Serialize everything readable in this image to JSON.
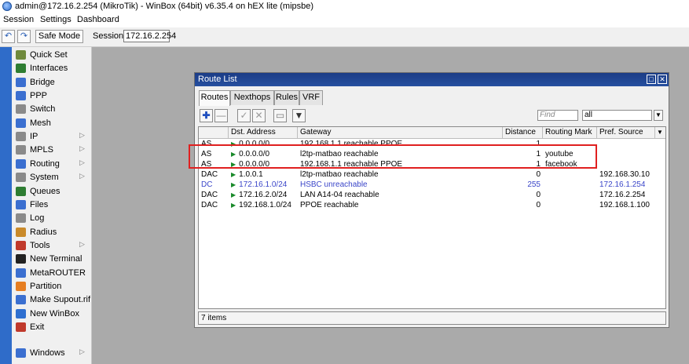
{
  "window": {
    "title": "admin@172.16.2.254 (MikroTik) - WinBox (64bit) v6.35.4 on hEX lite (mipsbe)"
  },
  "menu": [
    "Session",
    "Settings",
    "Dashboard"
  ],
  "toolbar": {
    "undo_icon": "undo-icon",
    "redo_icon": "redo-icon",
    "safe_mode_label": "Safe Mode",
    "session_label": "Session:",
    "session_value": "172.16.2.254"
  },
  "sidebar": {
    "items": [
      {
        "label": "Quick Set",
        "icon": "quick-set-icon",
        "color": "#6f8a3c",
        "submenu": false
      },
      {
        "label": "Interfaces",
        "icon": "interfaces-icon",
        "color": "#2e7d32",
        "submenu": false
      },
      {
        "label": "Bridge",
        "icon": "bridge-icon",
        "color": "#3b6fd0",
        "submenu": false
      },
      {
        "label": "PPP",
        "icon": "ppp-icon",
        "color": "#3b6fd0",
        "submenu": false
      },
      {
        "label": "Switch",
        "icon": "switch-icon",
        "color": "#8a8a8a",
        "submenu": false
      },
      {
        "label": "Mesh",
        "icon": "mesh-icon",
        "color": "#3b6fd0",
        "submenu": false
      },
      {
        "label": "IP",
        "icon": "ip-icon",
        "color": "#8a8a8a",
        "submenu": true
      },
      {
        "label": "MPLS",
        "icon": "mpls-icon",
        "color": "#8a8a8a",
        "submenu": true
      },
      {
        "label": "Routing",
        "icon": "routing-icon",
        "color": "#3b6fd0",
        "submenu": true
      },
      {
        "label": "System",
        "icon": "system-icon",
        "color": "#8a8a8a",
        "submenu": true
      },
      {
        "label": "Queues",
        "icon": "queues-icon",
        "color": "#2e7d32",
        "submenu": false
      },
      {
        "label": "Files",
        "icon": "files-icon",
        "color": "#3b6fd0",
        "submenu": false
      },
      {
        "label": "Log",
        "icon": "log-icon",
        "color": "#8a8a8a",
        "submenu": false
      },
      {
        "label": "Radius",
        "icon": "radius-icon",
        "color": "#c98a2a",
        "submenu": false
      },
      {
        "label": "Tools",
        "icon": "tools-icon",
        "color": "#c0392b",
        "submenu": true
      },
      {
        "label": "New Terminal",
        "icon": "terminal-icon",
        "color": "#222222",
        "submenu": false
      },
      {
        "label": "MetaROUTER",
        "icon": "metarouter-icon",
        "color": "#3b6fd0",
        "submenu": false
      },
      {
        "label": "Partition",
        "icon": "partition-icon",
        "color": "#e67e22",
        "submenu": false
      },
      {
        "label": "Make Supout.rif",
        "icon": "supout-icon",
        "color": "#3b6fd0",
        "submenu": false
      },
      {
        "label": "New WinBox",
        "icon": "winbox-icon",
        "color": "#2e6fd0",
        "submenu": false
      },
      {
        "label": "Exit",
        "icon": "exit-icon",
        "color": "#c0392b",
        "submenu": false
      }
    ],
    "windows": {
      "label": "Windows",
      "icon": "windows-icon",
      "color": "#3b6fd0",
      "submenu": true
    }
  },
  "route_list": {
    "title": "Route List",
    "tabs": [
      "Routes",
      "Nexthops",
      "Rules",
      "VRF"
    ],
    "active_tab": "Routes",
    "find_placeholder": "Find",
    "filter_value": "all",
    "columns": [
      "",
      "Dst. Address",
      "Gateway",
      "Distance",
      "Routing Mark",
      "Pref. Source"
    ],
    "rows": [
      {
        "flags": "AS",
        "dst": "0.0.0.0/0",
        "gateway": "192.168.1.1 reachable PPOE",
        "distance": "1",
        "mark": "",
        "pref": "",
        "blue": false
      },
      {
        "flags": "AS",
        "dst": "0.0.0.0/0",
        "gateway": "l2tp-matbao reachable",
        "distance": "1",
        "mark": "youtube",
        "pref": "",
        "blue": false
      },
      {
        "flags": "AS",
        "dst": "0.0.0.0/0",
        "gateway": "192.168.1.1 reachable PPOE",
        "distance": "1",
        "mark": "facebook",
        "pref": "",
        "blue": false
      },
      {
        "flags": "DAC",
        "dst": "1.0.0.1",
        "gateway": "l2tp-matbao reachable",
        "distance": "0",
        "mark": "",
        "pref": "192.168.30.10",
        "blue": false
      },
      {
        "flags": "DC",
        "dst": "172.16.1.0/24",
        "gateway": "HSBC unreachable",
        "distance": "255",
        "mark": "",
        "pref": "172.16.1.254",
        "blue": true
      },
      {
        "flags": "DAC",
        "dst": "172.16.2.0/24",
        "gateway": "LAN A14-04 reachable",
        "distance": "0",
        "mark": "",
        "pref": "172.16.2.254",
        "blue": false
      },
      {
        "flags": "DAC",
        "dst": "192.168.1.0/24",
        "gateway": "PPOE reachable",
        "distance": "0",
        "mark": "",
        "pref": "192.168.1.100",
        "blue": false
      }
    ],
    "status": "7 items"
  },
  "colors": {
    "highlight": "#e02020",
    "title_bar": "#1b3c86",
    "left_strip": "#2f6cc9",
    "unreachable": "#3b46c9"
  }
}
